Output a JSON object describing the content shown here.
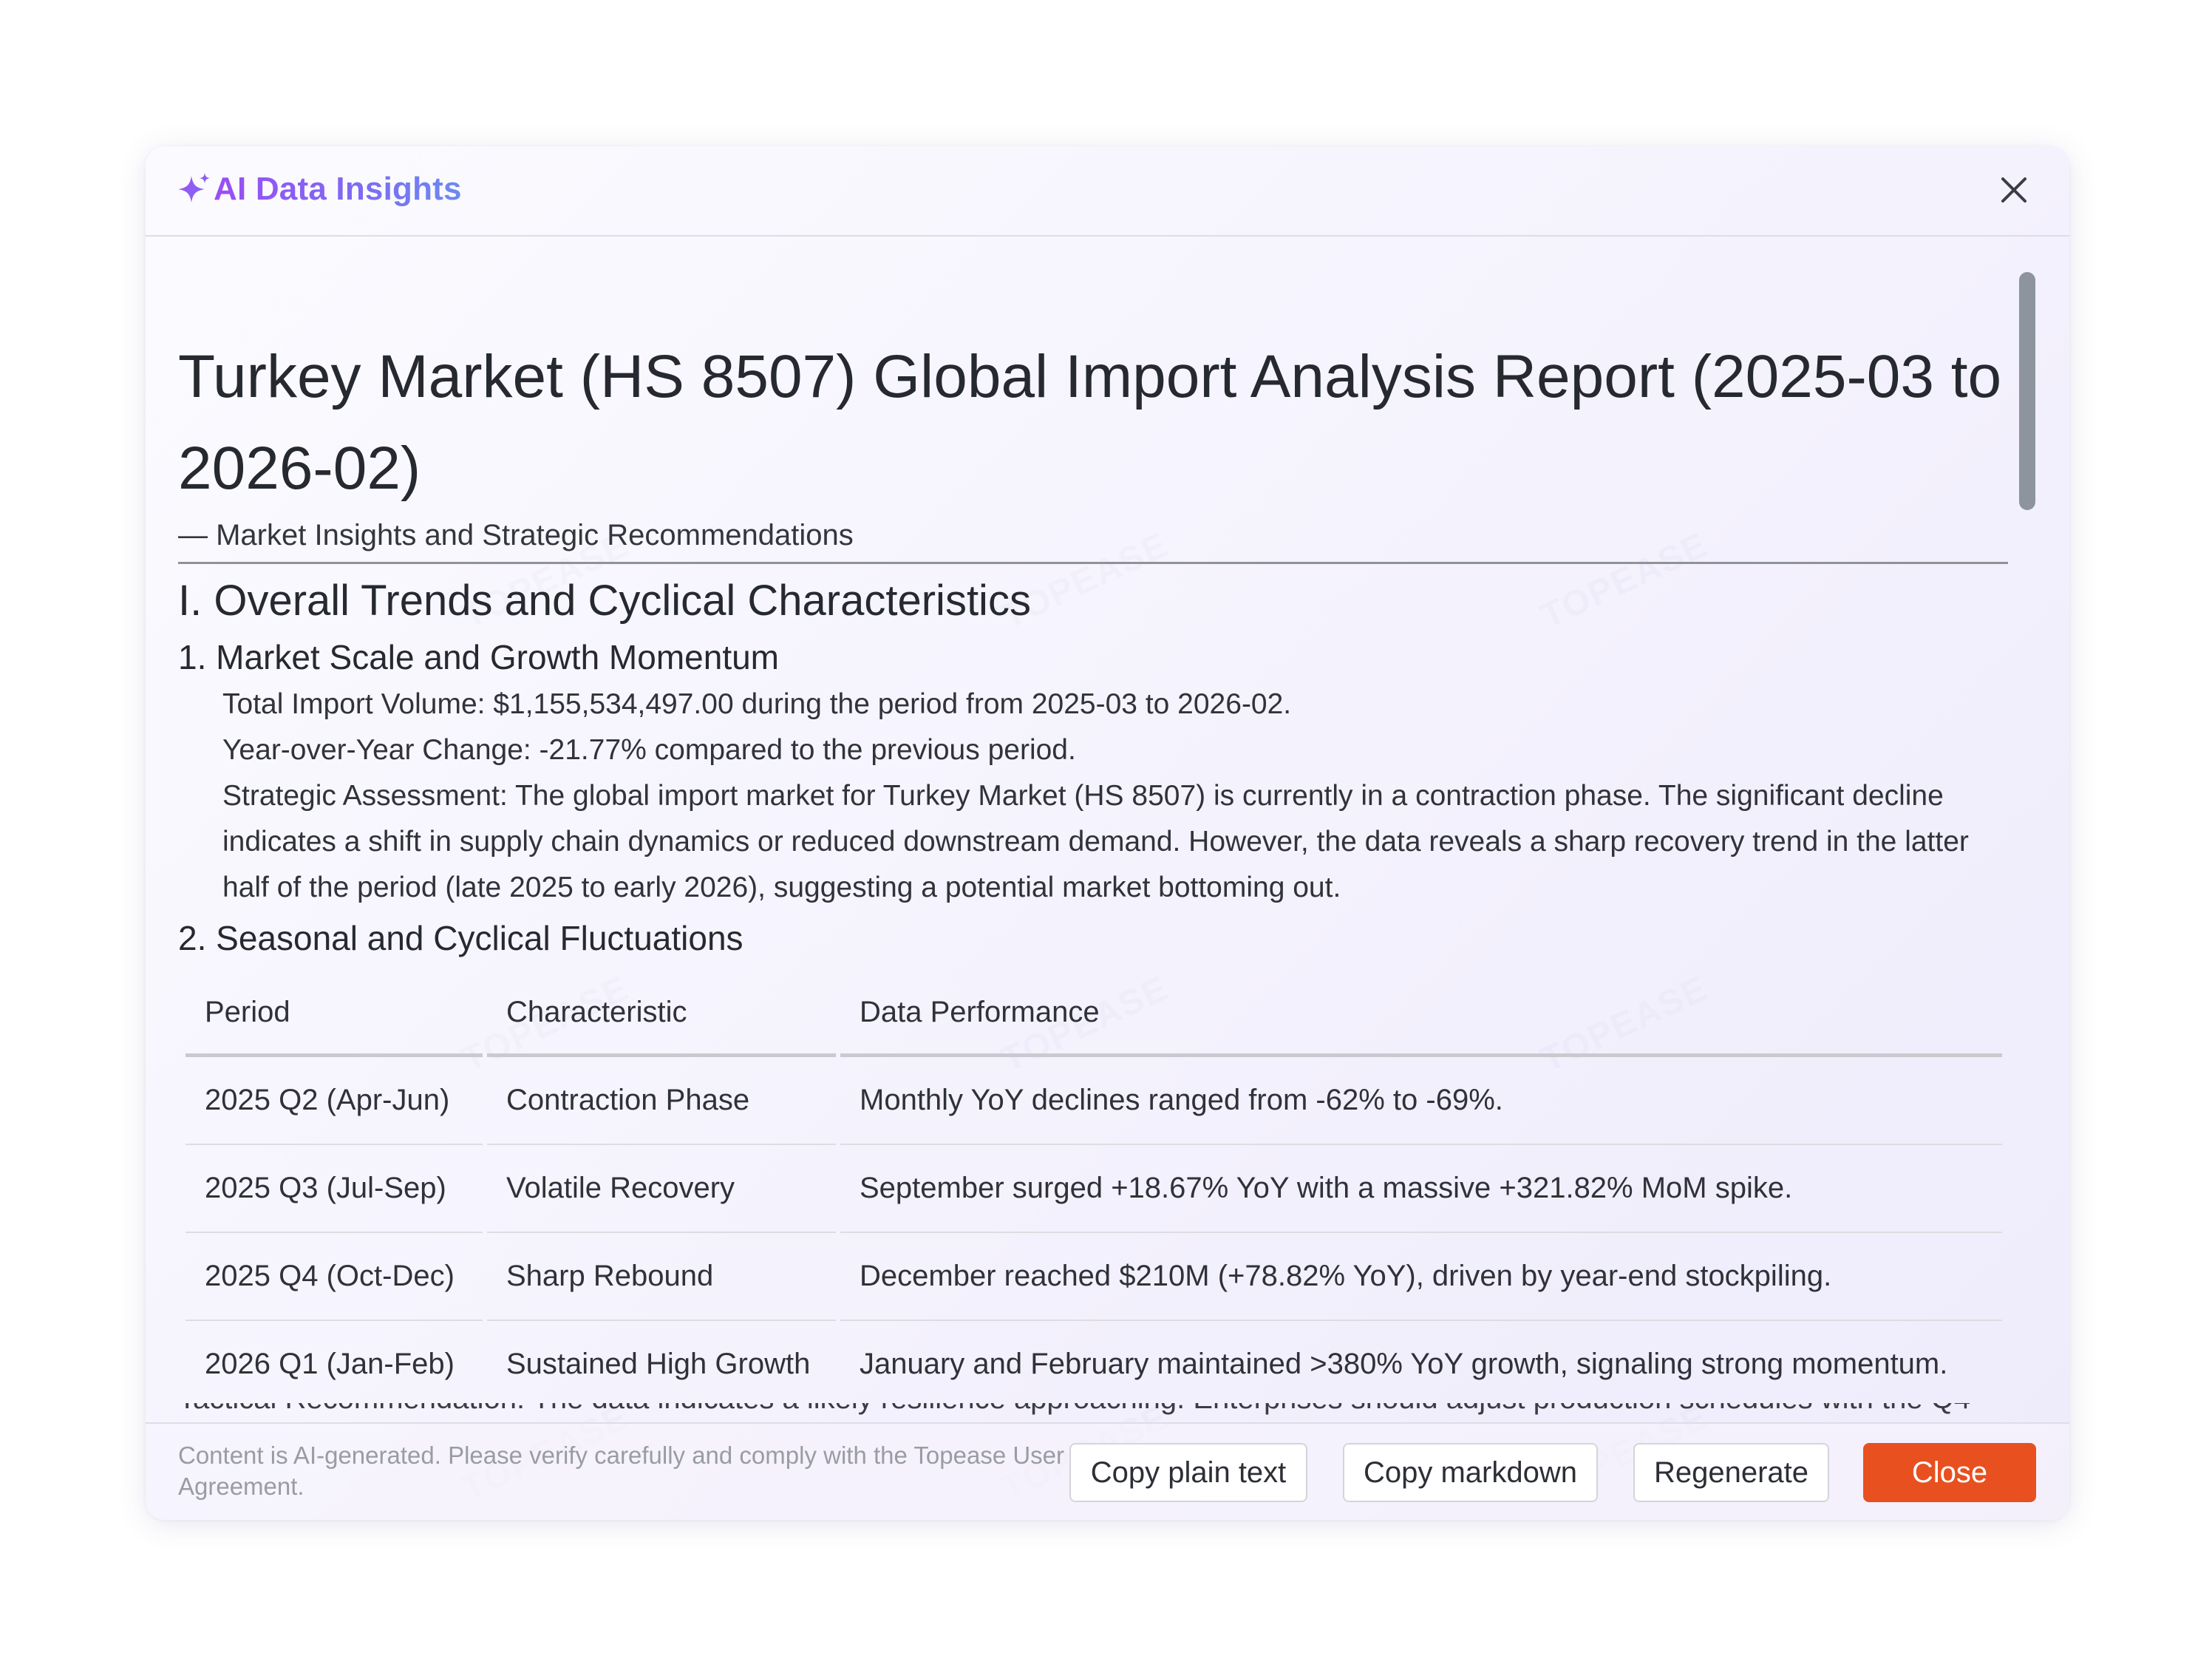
{
  "dialog": {
    "title": "AI Data Insights",
    "close_icon": "close-icon",
    "sparkle_icon": "sparkle-icon",
    "accent_gradient": [
      "#9b4df5",
      "#6d8af0"
    ]
  },
  "report": {
    "title": "Turkey Market (HS 8507) Global Import Analysis Report (2025-03 to 2026-02)",
    "subtitle": "— Market Insights and Strategic Recommendations",
    "section1": {
      "heading": "I. Overall Trends and Cyclical Characteristics",
      "sub1": {
        "heading": "1. Market Scale and Growth Momentum",
        "total_import": "Total Import Volume: $1,155,534,497.00 during the period from 2025-03 to 2026-02.",
        "yoy_change": "Year-over-Year Change: -21.77% compared to the previous period.",
        "assessment": "Strategic Assessment: The global import market for Turkey Market (HS 8507) is currently in a contraction phase. The significant decline indicates a shift in supply chain dynamics or reduced downstream demand. However, the data reveals a sharp recovery trend in the latter half of the period (late 2025 to early 2026), suggesting a potential market bottoming out."
      },
      "sub2": {
        "heading": "2. Seasonal and Cyclical Fluctuations",
        "table": {
          "headers": [
            "Period",
            "Characteristic",
            "Data Performance"
          ],
          "rows": [
            [
              "2025 Q2 (Apr-Jun)",
              "Contraction Phase",
              "Monthly YoY declines ranged from -62% to -69%."
            ],
            [
              "2025 Q3 (Jul-Sep)",
              "Volatile Recovery",
              "September surged +18.67% YoY with a massive +321.82% MoM spike."
            ],
            [
              "2025 Q4 (Oct-Dec)",
              "Sharp Rebound",
              "December reached $210M (+78.82% YoY), driven by year-end stockpiling."
            ],
            [
              "2026 Q1 (Jan-Feb)",
              "Sustained High Growth",
              "January and February maintained >380% YoY growth, signaling strong momentum."
            ]
          ]
        }
      }
    },
    "partial_text": "Tactical Recommendation: The data indicates a likely resilience approaching. Enterprises should adjust production schedules with the Q4"
  },
  "footer": {
    "disclaimer": "Content is AI-generated. Please verify carefully and comply with the Topease User Agreement.",
    "copy_plain_label": "Copy plain text",
    "copy_markdown_label": "Copy markdown",
    "regenerate_label": "Regenerate",
    "close_label": "Close",
    "close_color": "#e8501f"
  }
}
